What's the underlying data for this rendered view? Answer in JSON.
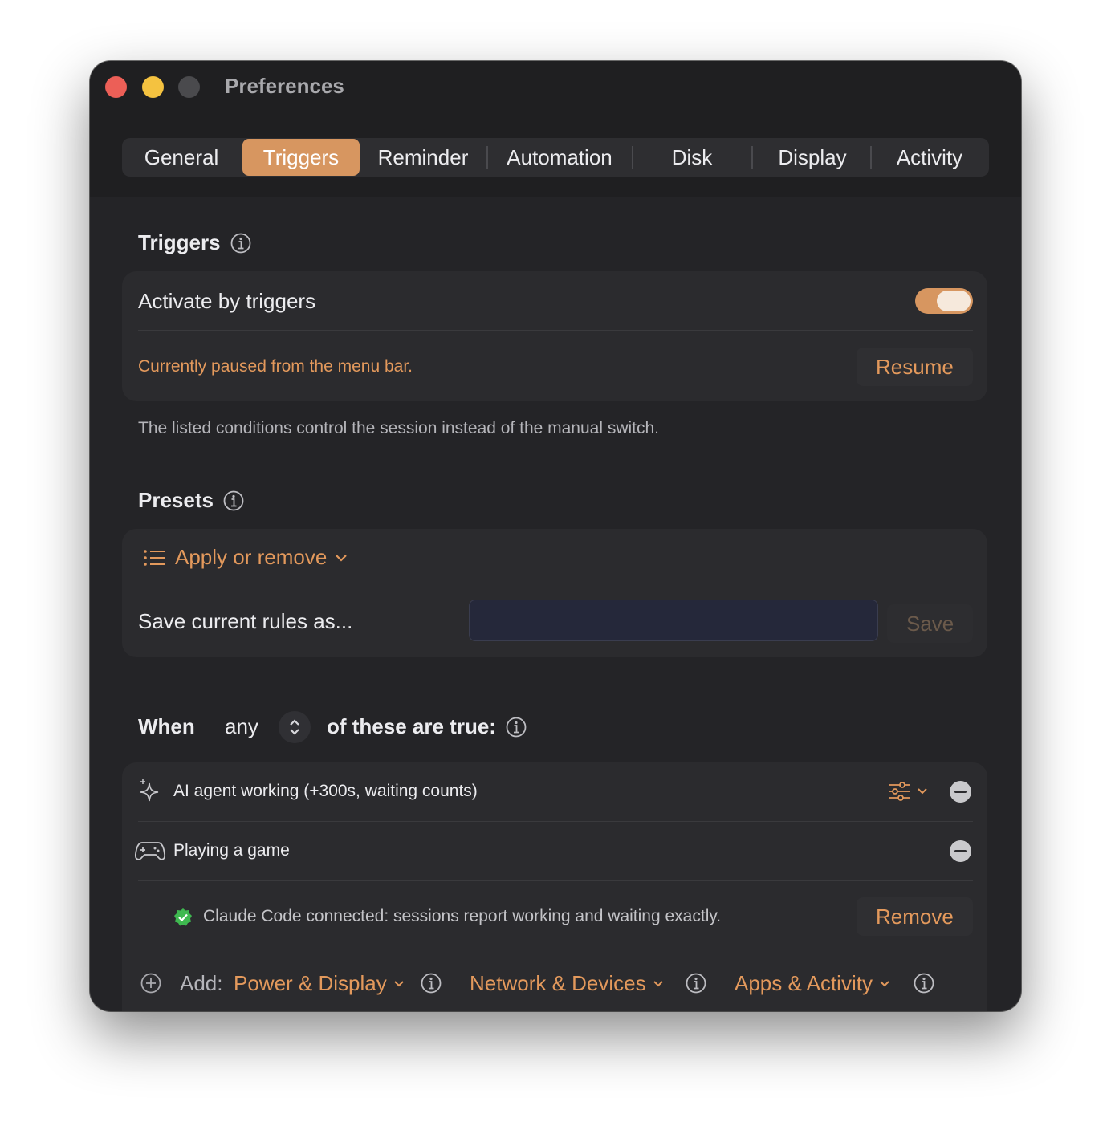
{
  "window": {
    "title": "Preferences"
  },
  "tabs": [
    {
      "label": "General",
      "active": false
    },
    {
      "label": "Triggers",
      "active": true
    },
    {
      "label": "Reminder",
      "active": false
    },
    {
      "label": "Automation",
      "active": false
    },
    {
      "label": "Disk",
      "active": false
    },
    {
      "label": "Display",
      "active": false
    },
    {
      "label": "Activity",
      "active": false
    }
  ],
  "triggers": {
    "title": "Triggers",
    "activate_label": "Activate by triggers",
    "activate_on": true,
    "paused_text": "Currently paused from the menu bar.",
    "resume_label": "Resume",
    "description": "The listed conditions control the session instead of the manual switch."
  },
  "presets": {
    "title": "Presets",
    "apply_label": "Apply or remove",
    "save_rules_label": "Save current rules as...",
    "save_input_value": "",
    "save_label": "Save"
  },
  "conditions": {
    "when_label": "When",
    "match_value": "any",
    "suffix_label": "of these are true:",
    "items": [
      {
        "label": "AI agent working (+300s, waiting counts)",
        "icon": "sparkles-icon"
      },
      {
        "label": "Playing a game",
        "icon": "gamepad-icon"
      }
    ],
    "status_text": "Claude Code connected: sessions report working and waiting exactly.",
    "remove_label": "Remove",
    "add_label": "Add:",
    "add_options": [
      "Power & Display",
      "Network & Devices",
      "Apps & Activity"
    ]
  },
  "colors": {
    "accent": "#d79660",
    "accent_text": "#e3995c",
    "window_bg": "#242427",
    "card_bg": "#2b2b2e",
    "success": "#3fb950"
  }
}
